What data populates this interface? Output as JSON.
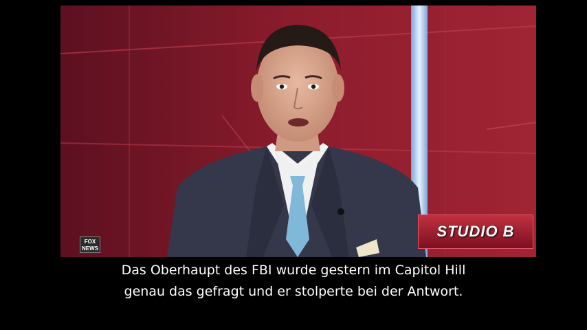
{
  "video": {
    "network_logo_text": "FOX NEWS",
    "show_logo_text": "STUDIO B",
    "colors": {
      "background": "#000000",
      "studio_red": "#8a1a2a",
      "suit": "#34384a",
      "tie": "#7fb8d8",
      "shirt": "#f2f2f2"
    }
  },
  "subtitles": {
    "line1": "Das Oberhaupt des FBI wurde gestern im Capitol Hill",
    "line2": "genau das gefragt und er stolperte bei der Antwort."
  }
}
